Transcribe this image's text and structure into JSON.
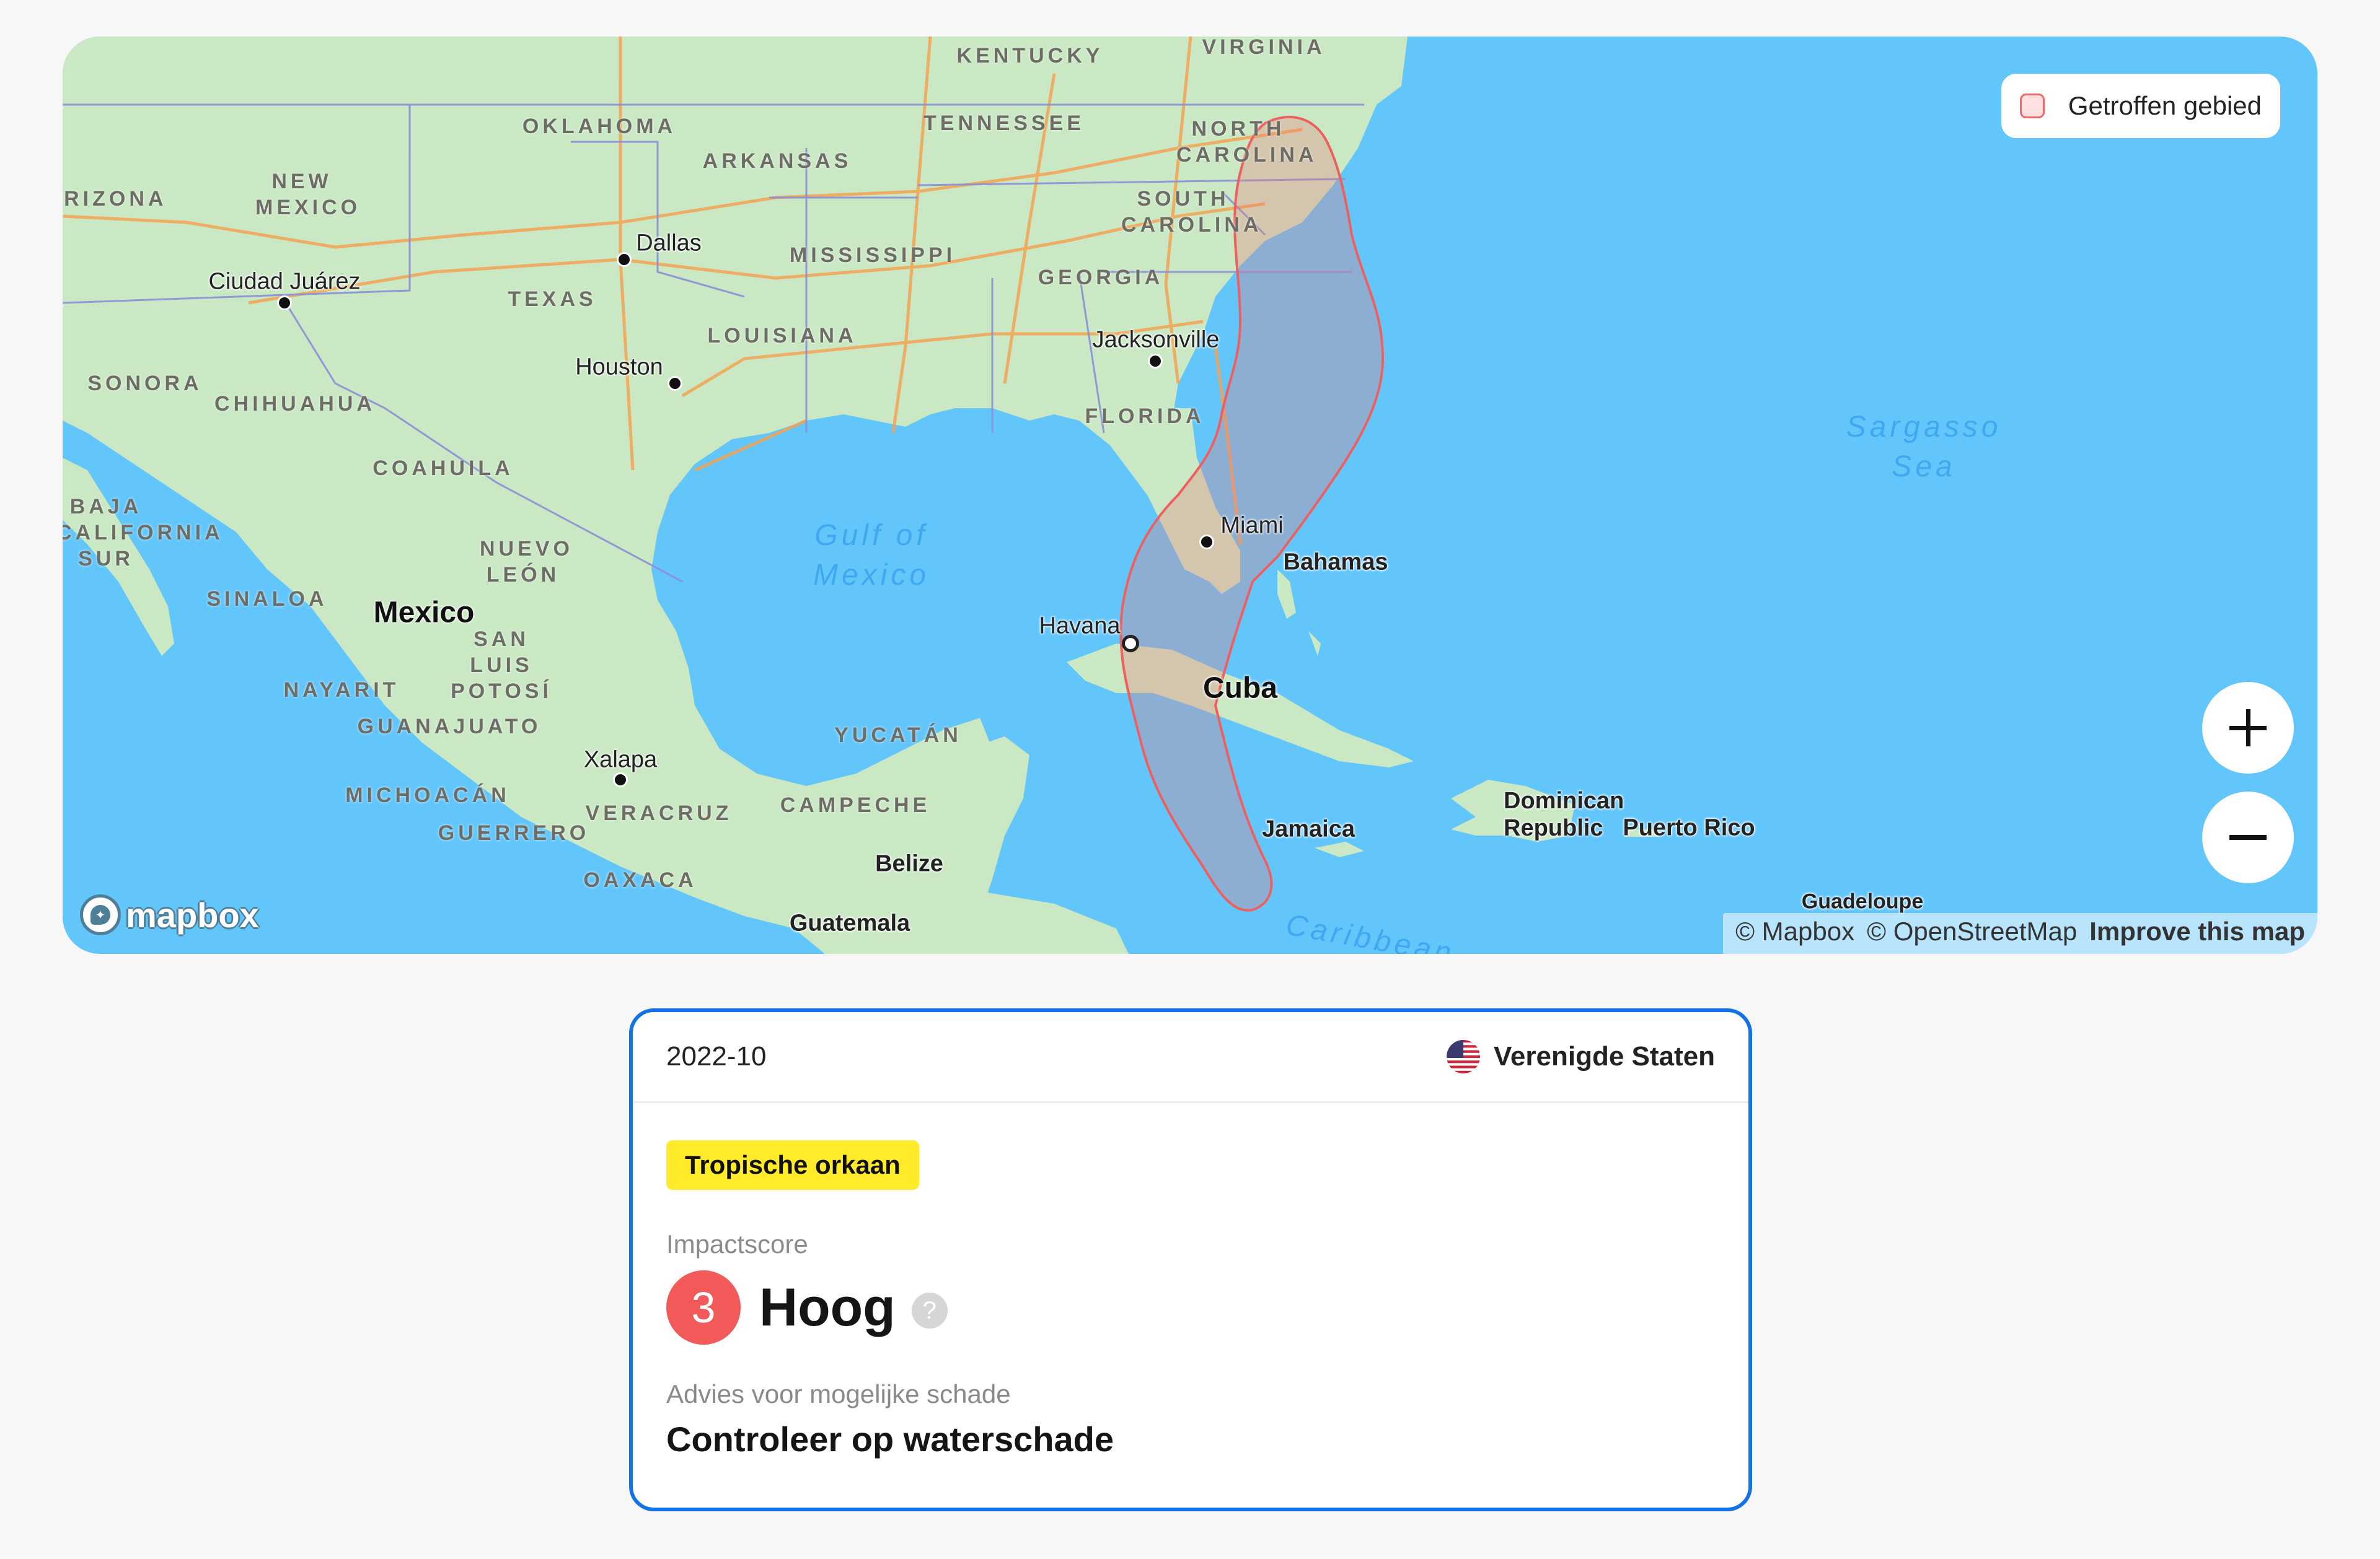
{
  "map": {
    "legend": {
      "label": "Getroffen gebied",
      "swatch_fill": "#ffe0e0",
      "swatch_stroke": "#f06a6a"
    },
    "zoom_in_label": "+",
    "zoom_out_label": "−",
    "attribution": {
      "mapbox": "© Mapbox",
      "osm": "© OpenStreetMap",
      "improve": "Improve this map"
    },
    "logo_text": "mapbox",
    "labels": {
      "states": [
        "KENTUCKY",
        "VIRGINIA",
        "OKLAHOMA",
        "TENNESSEE",
        "NORTH CAROLINA",
        "ARKANSAS",
        "ARIZONA",
        "NEW MEXICO",
        "SOUTH CAROLINA",
        "MISSISSIPPI",
        "GEORGIA",
        "TEXAS",
        "LOUISIANA",
        "FLORIDA",
        "SONORA",
        "CHIHUAHUA",
        "COAHUILA",
        "BAJA CALIFORNIA SUR",
        "NUEVO LEÓN",
        "SINALOA",
        "SAN LUIS POTOSÍ",
        "NAYARIT",
        "GUANAJUATO",
        "MICHOACÁN",
        "VERACRUZ",
        "GUERRERO",
        "OAXACA",
        "YUCATÁN",
        "CAMPECHE"
      ],
      "cities": [
        "Dallas",
        "Ciudad Juárez",
        "Houston",
        "Jacksonville",
        "Miami",
        "Havana",
        "Xalapa"
      ],
      "countries": [
        "Mexico",
        "Cuba",
        "Bahamas",
        "Jamaica",
        "Dominican Republic",
        "Puerto Rico",
        "Belize",
        "Guatemala",
        "Guadeloupe"
      ],
      "seas": [
        "Gulf of Mexico",
        "Sargasso Sea",
        "Caribbean"
      ]
    }
  },
  "card": {
    "date": "2022-10",
    "country": "Verenigde Staten",
    "country_flag": "us-flag",
    "event_type": "Tropische orkaan",
    "event_color": "#ffeb2a",
    "impact_label": "Impactscore",
    "impact_score": "3",
    "impact_level": "Hoog",
    "impact_color": "#f25a5a",
    "help_symbol": "?",
    "advice_label": "Advies voor mogelijke schade",
    "advice": "Controleer op waterschade",
    "border_color": "#1373e6"
  }
}
